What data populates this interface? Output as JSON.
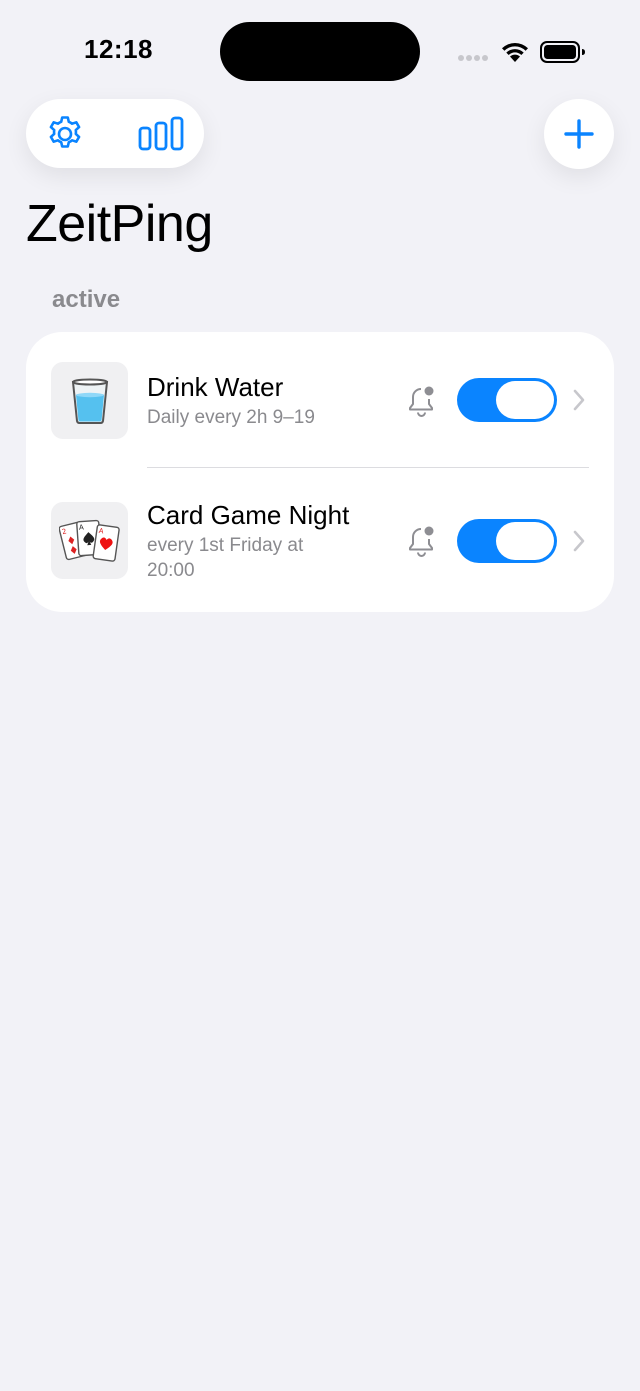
{
  "status_bar": {
    "time": "12:18"
  },
  "toolbar": {
    "settings_icon": "gear-icon",
    "stats_icon": "bar-chart-icon",
    "add_icon": "plus-icon",
    "accent_color": "#0a84ff"
  },
  "app_title": "ZeitPing",
  "section": {
    "label": "active",
    "items": [
      {
        "icon": "glass-of-water-icon",
        "title": "Drink Water",
        "subtitle": "Daily every 2h 9–19",
        "notification_icon": "bell-badge-icon",
        "enabled": true
      },
      {
        "icon": "playing-cards-icon",
        "title": "Card Game Night",
        "subtitle": "every 1st Friday at 20:00",
        "notification_icon": "bell-badge-icon",
        "enabled": true
      }
    ]
  }
}
